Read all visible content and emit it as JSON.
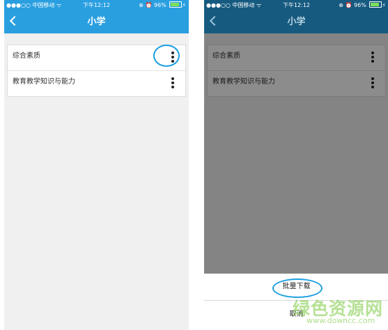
{
  "left": {
    "status": {
      "carrier": "●●●○○ 中国移动 ᯤ",
      "time": "下午12:12",
      "right": "⊕ ⏰ 96%"
    },
    "nav": {
      "title": "小学"
    },
    "items": [
      {
        "label": "综合素质"
      },
      {
        "label": "教育教学知识与能力"
      }
    ]
  },
  "right": {
    "status": {
      "carrier": "●●●○○ 中国移动 ᯤ",
      "time": "下午12:12",
      "right": "⊕ ⏰ 96%"
    },
    "nav": {
      "title": "小学"
    },
    "items": [
      {
        "label": "综合素质"
      },
      {
        "label": "教育教学知识与能力"
      }
    ],
    "action_sheet": {
      "download_label": "批量下载",
      "cancel_label": "取消"
    }
  },
  "watermark": {
    "title": "绿色资源网",
    "url": "www.downcc.com"
  },
  "colors": {
    "nav_bg_active": "#2a9fe0",
    "nav_bg_dimmed": "#165a80",
    "highlight": "#1a9ee0",
    "battery": "#7be05a"
  },
  "icons": [
    "chevron-left-icon",
    "more-vertical-icon",
    "battery-icon",
    "alarm-icon",
    "wifi-icon"
  ]
}
